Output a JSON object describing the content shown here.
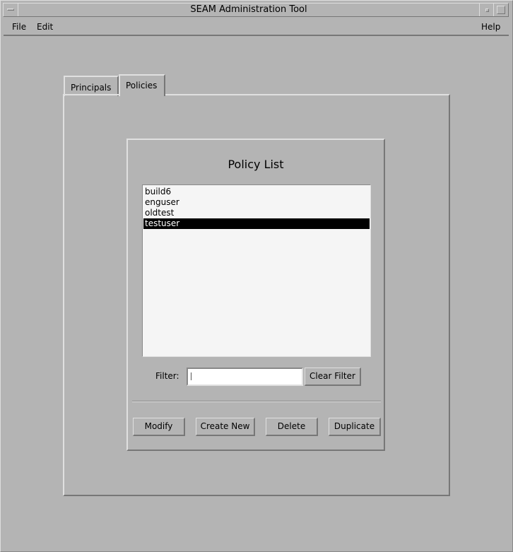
{
  "window": {
    "title": "SEAM Administration Tool"
  },
  "menubar": {
    "file": "File",
    "edit": "Edit",
    "help": "Help"
  },
  "tabs": [
    {
      "label": "Principals",
      "selected": false
    },
    {
      "label": "Policies",
      "selected": true
    }
  ],
  "policy_panel": {
    "title": "Policy List",
    "items": [
      {
        "label": "build6",
        "selected": false
      },
      {
        "label": "enguser",
        "selected": false
      },
      {
        "label": "oldtest",
        "selected": false
      },
      {
        "label": "testuser",
        "selected": true
      }
    ],
    "filter_label": "Filter:",
    "filter_value": "",
    "clear_filter_label": "Clear Filter",
    "buttons": {
      "modify": "Modify",
      "create_new": "Create New",
      "delete": "Delete",
      "duplicate": "Duplicate"
    }
  }
}
